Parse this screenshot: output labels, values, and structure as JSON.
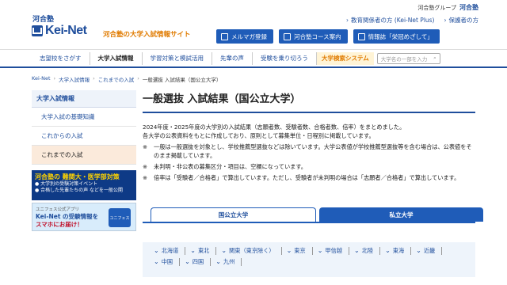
{
  "header": {
    "logo_sub": "河合塾",
    "logo_name": "Kei-Net",
    "tagline": "河合塾の大学入試情報サイト",
    "group_label": "河合塾グループ",
    "group_brand": "河合塾",
    "top_links": [
      "教育関係者の方 (Kei-Net Plus)",
      "保護者の方"
    ],
    "buttons": [
      "メルマガ登録",
      "河合塾コース案内",
      "情報誌「栄冠めざして」"
    ]
  },
  "nav": {
    "items": [
      "志望校をさがす",
      "大学入試情報",
      "学習対策と模試活用",
      "先輩の声",
      "受験を乗り切ろう"
    ],
    "search_system": "大学検索システム",
    "search_placeholder": "大学名の一部を入力"
  },
  "breadcrumb": [
    "Kei-Net",
    "大学入試情報",
    "これまでの入試",
    "一般選抜 入試結果（国公立大学）"
  ],
  "sidebar": {
    "heading": "大学入試情報",
    "items": [
      "大学入試の基礎知識",
      "これからの入試",
      "これまでの入試"
    ]
  },
  "banner1": {
    "title": "河合塾の 難関大・医学部対策",
    "lines": [
      "● 大学別の受験対策イベント",
      "● 合格した先輩たちの声 などを一般公開"
    ]
  },
  "banner2": {
    "small": "ユニフェス公式アプリ",
    "line1": "Kei-Net の受験情報を",
    "line2": "スマホにお届け！",
    "box": "ユニフェス"
  },
  "main": {
    "title": "一般選抜 入試結果（国公立大学）",
    "para1": "2024年度・2025年度の大学別の入試結果（志願者数、受験者数、合格者数、倍率）をまとめました。",
    "para2": "各大学の公表資料をもとに作成しており、原則として募集単位・日程別に掲載しています。",
    "notes": [
      "一般は一般選抜を対象とし、学校推薦型選抜などは除いています。大学公表値が学校推薦型選抜等を含む場合は、公表値をそのまま掲載しています。",
      "未判明・非公表の募集区分・項目は、空欄になっています。",
      "倍率は「受験者／合格者」で算出しています。ただし、受験者が未判明の場合は「志願者／合格者」で算出しています。"
    ],
    "note_mark": "※"
  },
  "tabs": [
    "国公立大学",
    "私立大学"
  ],
  "regions": [
    "北海道",
    "東北",
    "関東（東京除く）",
    "東京",
    "甲信越",
    "北陸",
    "東海",
    "近畿",
    "中国",
    "四国",
    "九州"
  ]
}
